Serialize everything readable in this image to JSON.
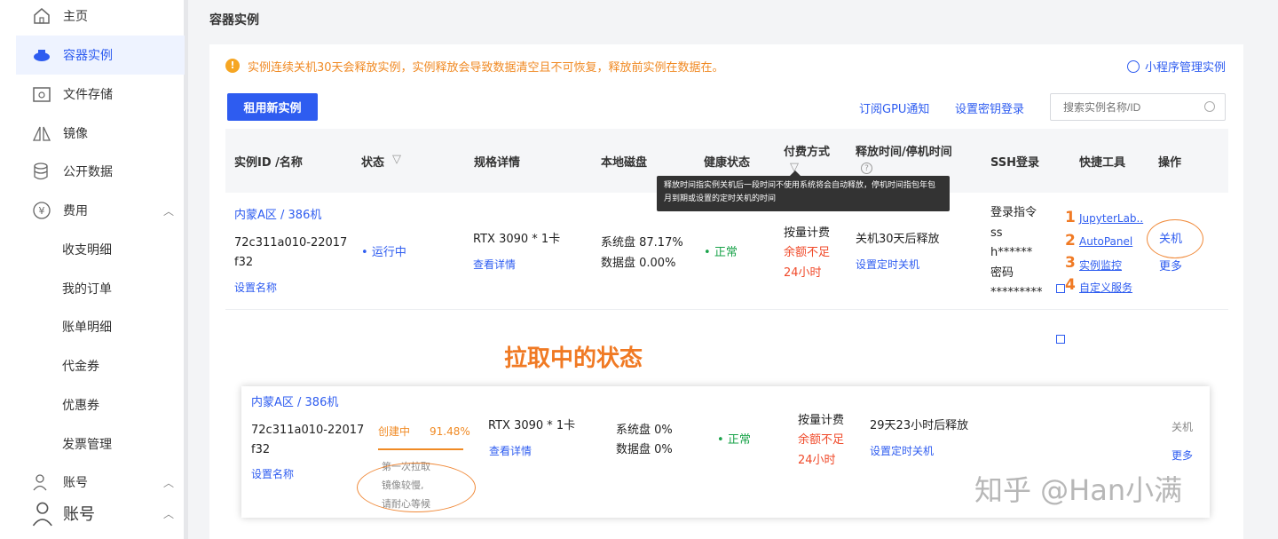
{
  "sidebar": {
    "items": [
      {
        "label": "主页",
        "icon": "home-icon"
      },
      {
        "label": "容器实例",
        "icon": "container-icon"
      },
      {
        "label": "文件存储",
        "icon": "storage-icon"
      },
      {
        "label": "镜像",
        "icon": "image-icon"
      },
      {
        "label": "公开数据",
        "icon": "database-icon"
      },
      {
        "label": "费用",
        "icon": "yuan-icon"
      }
    ],
    "fee_sub": [
      "收支明细",
      "我的订单",
      "账单明细",
      "代金券",
      "优惠券",
      "发票管理"
    ],
    "account1": "账号",
    "account2": "账号"
  },
  "main": {
    "title": "容器实例",
    "warning": "实例连续关机30天会释放实例，实例释放会导致数据清空且不可恢复，释放前实例在数据在。",
    "mini_program": "小程序管理实例",
    "rent_button": "租用新实例",
    "subscribe_gpu": "订阅GPU通知",
    "set_key_login": "设置密钥登录",
    "search_placeholder": "搜索实例名称/ID"
  },
  "table": {
    "headers": {
      "id_name": "实例ID /名称",
      "status": "状态",
      "spec": "规格详情",
      "disk": "本地磁盘",
      "health": "健康状态",
      "billing": "付费方式",
      "release": "释放时间/停机时间",
      "ssh": "SSH登录",
      "tools": "快捷工具",
      "ops": "操作"
    },
    "tooltip": "释放时间指实例关机后一段时间不使用系统将会自动释放，停机时间指包年包月到期或设置的定时关机的时间"
  },
  "row1": {
    "region": "内蒙A区 / 386机",
    "id_line1": "72c311a010-22017",
    "id_line2": "f32",
    "set_name": "设置名称",
    "status": "运行中",
    "gpu": "RTX 3090 * 1卡",
    "view_detail": "查看详情",
    "sys_disk": "系统盘 87.17%",
    "data_disk": "数据盘 0.00%",
    "health": "正常",
    "billing": "按量计费",
    "balance_low_1": "余额不足",
    "balance_low_2": "24小时",
    "release": "关机30天后释放",
    "set_timer": "设置定时关机",
    "ssh_cmd": "登录指令",
    "ssh_l2": "ss",
    "ssh_l3": "h******",
    "ssh_pwd": "密码",
    "ssh_pwd_val": "*********",
    "tools": [
      {
        "num": "1",
        "label": "JupyterLab.."
      },
      {
        "num": "2",
        "label": "AutoPanel"
      },
      {
        "num": "3",
        "label": "实例监控"
      },
      {
        "num": "4",
        "label": "自定义服务"
      }
    ],
    "shutdown": "关机",
    "more": "更多"
  },
  "caption": "拉取中的状态",
  "row2": {
    "region": "内蒙A区 / 386机",
    "id_line1": "72c311a010-22017",
    "id_line2": "f32",
    "set_name": "设置名称",
    "status": "创建中",
    "progress_text": "91.48%",
    "progress": 0.9148,
    "hint1": "第一次拉取",
    "hint2": "镜像较慢,",
    "hint3": "请耐心等候",
    "gpu": "RTX 3090 * 1卡",
    "view_detail": "查看详情",
    "sys_disk": "系统盘 0%",
    "data_disk": "数据盘 0%",
    "health": "正常",
    "billing": "按量计费",
    "balance_low_1": "余额不足",
    "balance_low_2": "24小时",
    "release": "29天23小时后释放",
    "set_timer": "设置定时关机",
    "shutdown": "关机",
    "more": "更多"
  },
  "watermark": "知乎 @Han小满",
  "colors": {
    "accent": "#2e5cf0",
    "warning": "#f08a24",
    "success": "#1aa34a",
    "danger": "#f04a2a"
  }
}
